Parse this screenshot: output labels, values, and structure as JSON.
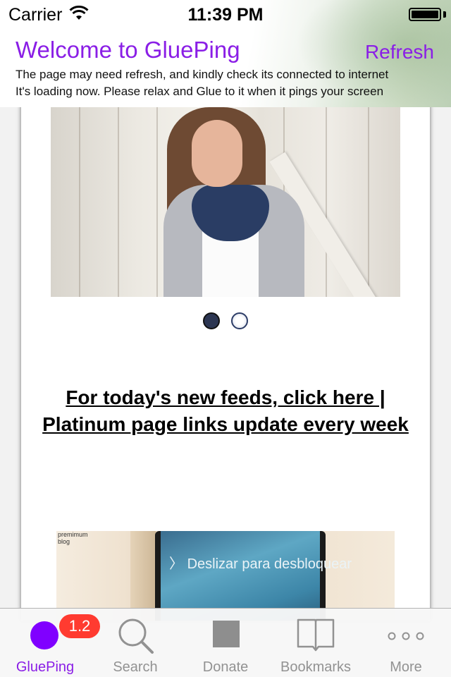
{
  "status_bar": {
    "carrier": "Carrier",
    "time": "11:39 PM",
    "wifi_icon": "wifi-icon",
    "battery_icon": "battery-icon",
    "battery_level": 1.0
  },
  "header": {
    "title": "Welcome to GluePing",
    "refresh_label": "Refresh",
    "message_line1": "The page may need refresh, and kindly check its connected to internet",
    "message_line2": "It's loading now. Please relax and Glue to it when it pings your screen",
    "accent_color": "#8a1ee6"
  },
  "content": {
    "carousel": {
      "image": "photo of woman with scarf leaning against white fence",
      "page_count": 2,
      "current_page": 1
    },
    "feed_link_text": "For today's new feeds, click here | Platinum page links update every week",
    "promo": {
      "corner_label_line1": "premimum",
      "corner_label_line2": "blog",
      "phone_text": "Deslizar para desbloquear"
    }
  },
  "tab_bar": {
    "tabs": [
      {
        "label": "GluePing",
        "icon": "glueping-circle-icon",
        "active": true,
        "badge": "1.2"
      },
      {
        "label": "Search",
        "icon": "search-icon",
        "active": false
      },
      {
        "label": "Donate",
        "icon": "donate-square-icon",
        "active": false
      },
      {
        "label": "Bookmarks",
        "icon": "book-icon",
        "active": false
      },
      {
        "label": "More",
        "icon": "more-icon",
        "active": false
      }
    ],
    "badge_color": "#ff3b30"
  }
}
